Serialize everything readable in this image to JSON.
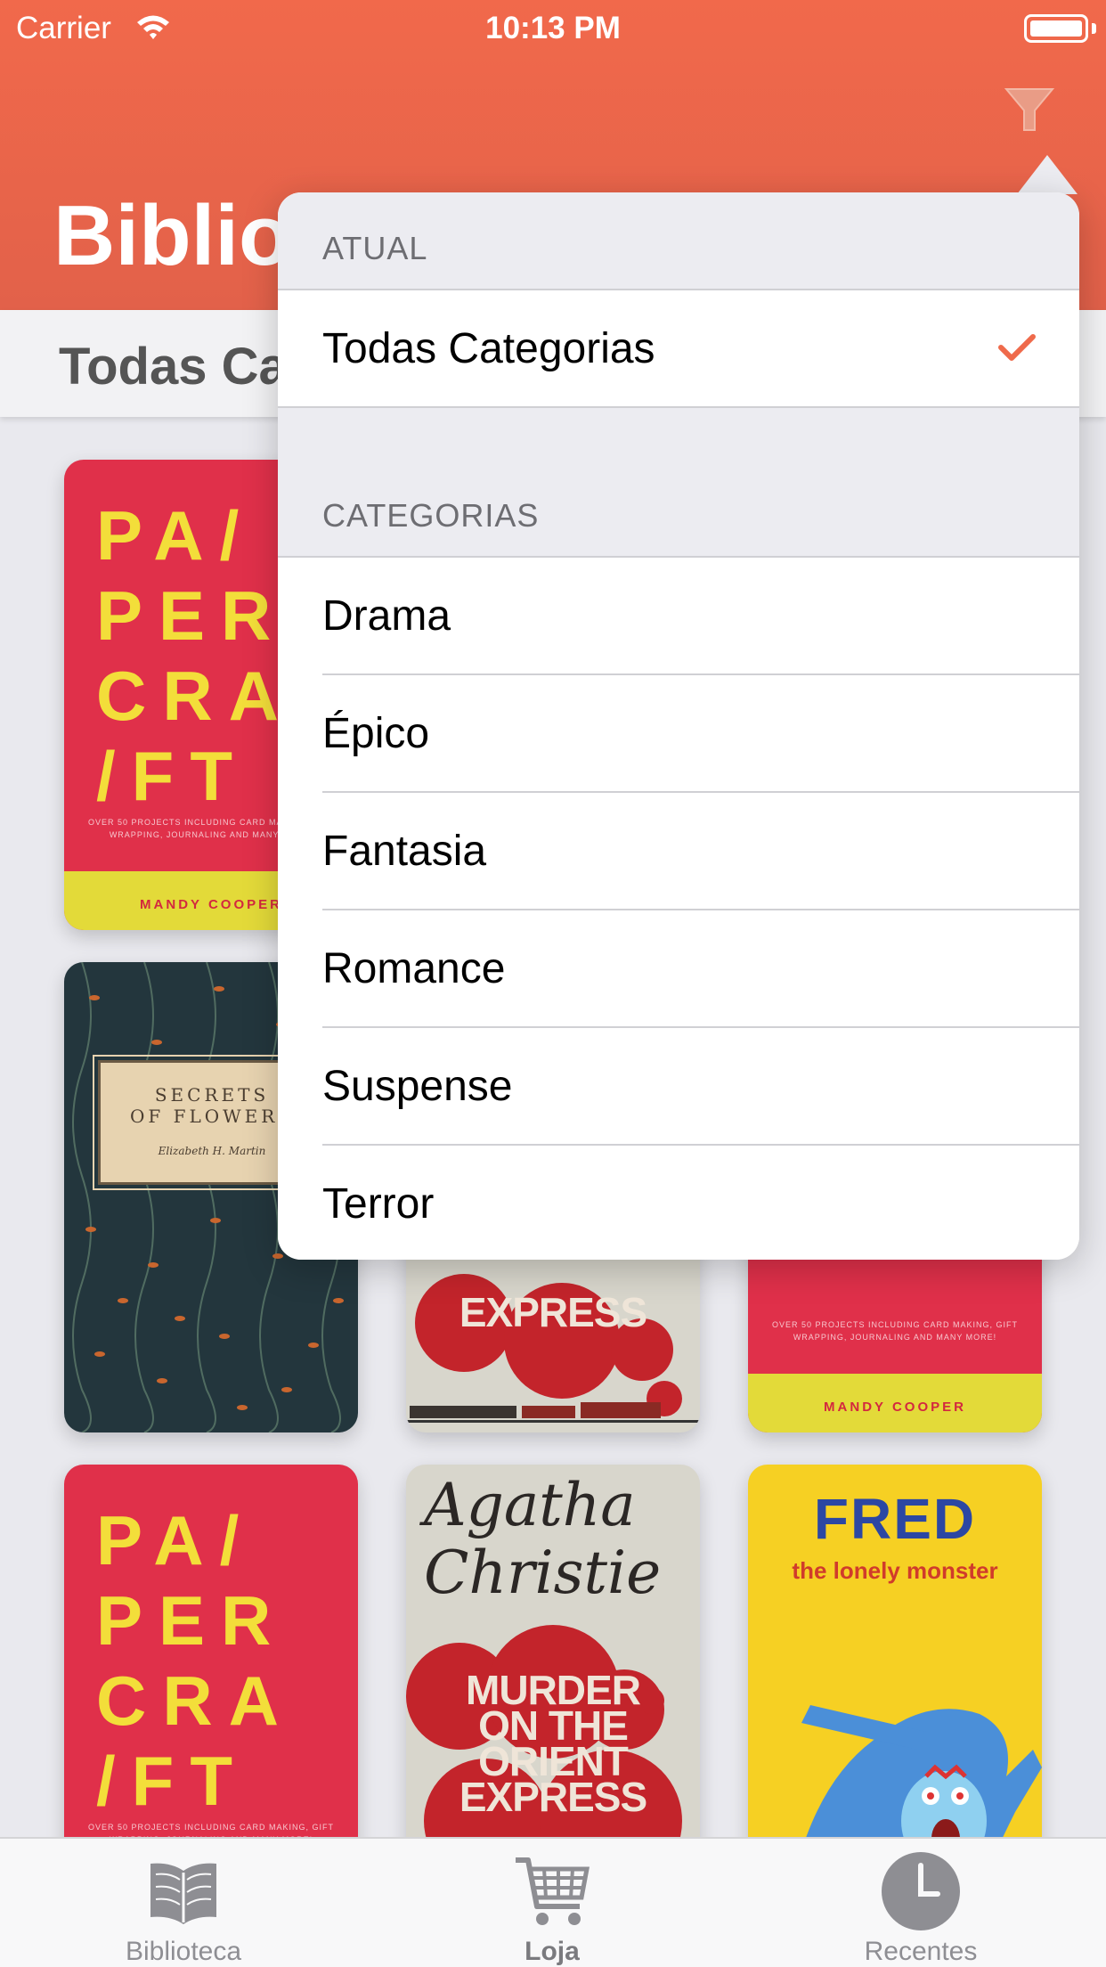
{
  "status_bar": {
    "carrier": "Carrier",
    "time": "10:13 PM"
  },
  "header": {
    "title": "Biblio"
  },
  "category_bar": {
    "label": "Todas Ca"
  },
  "popover": {
    "current_header": "ATUAL",
    "current_option": "Todas Categorias",
    "categories_header": "CATEGORIAS",
    "categories": [
      "Drama",
      "Épico",
      "Fantasia",
      "Romance",
      "Suspense",
      "Terror"
    ]
  },
  "books": {
    "papercraft": {
      "lines": [
        "PA/",
        "PER",
        "CRA",
        "/FT"
      ],
      "subtitle": "OVER 50 PROJECTS INCLUDING CARD MAKING, GIFT WRAPPING, JOURNALING AND MANY MORE!",
      "author": "MANDY COOPER"
    },
    "flowers": {
      "title_1": "SECRETS",
      "title_2": "OF FLOWERS",
      "author": "Elizabeth H. Martin"
    },
    "christie": {
      "author": "Agatha Christie",
      "title_1": "MURDER",
      "title_2": "ON THE",
      "title_3": "ORIENT",
      "title_4": "EXPRESS"
    },
    "fred": {
      "title": "FRED",
      "subtitle": "the lonely monster"
    }
  },
  "tabbar": {
    "tabs": [
      {
        "label": "Biblioteca"
      },
      {
        "label": "Loja"
      },
      {
        "label": "Recentes"
      }
    ]
  },
  "colors": {
    "accent": "#f1694b",
    "check": "#ef6a4b",
    "tab_icon": "#8e8e93"
  }
}
